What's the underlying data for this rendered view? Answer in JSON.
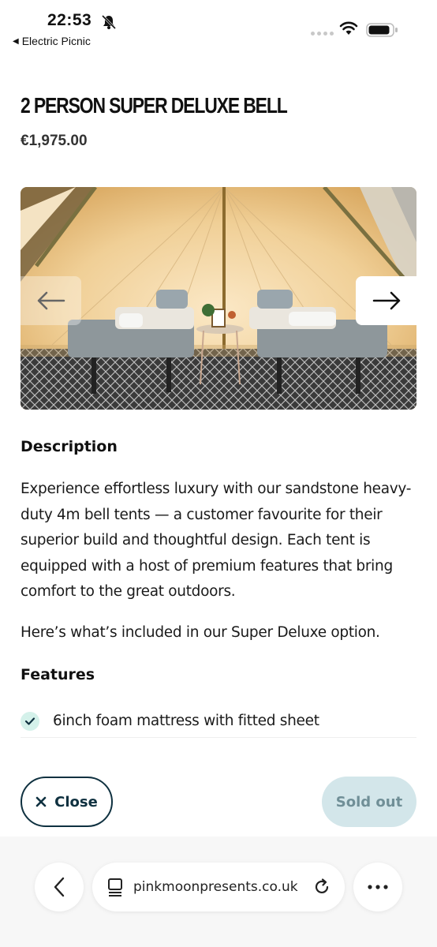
{
  "status_bar": {
    "time": "22:53",
    "back_app_label": "Electric Picnic",
    "icons": [
      "bell-slash-icon",
      "wifi-icon",
      "battery-icon"
    ]
  },
  "product": {
    "title": "2 PERSON SUPER DELUXE BELL",
    "price": "€1,975.00"
  },
  "gallery": {
    "prev_icon": "arrow-left-icon",
    "next_icon": "arrow-right-icon"
  },
  "description": {
    "heading": "Description",
    "paragraph_1": "Experience effortless luxury with our sandstone heavy-duty 4m bell tents — a customer favourite for their superior build and thoughtful design. Each tent is equipped with a host of premium features that bring  comfort to the great outdoors.",
    "paragraph_2": "Here’s what’s included in our Super Deluxe option."
  },
  "features": {
    "heading": "Features",
    "items": [
      "6inch foam mattress with fitted sheet"
    ]
  },
  "actions": {
    "close_label": "Close",
    "sold_out_label": "Sold out"
  },
  "browser": {
    "url": "pinkmoonpresents.co.uk",
    "icons": [
      "chevron-left-icon",
      "tabs-icon",
      "reload-icon",
      "more-icon"
    ]
  },
  "colors": {
    "brand_dark": "#0f3140",
    "check_bg": "#d4f1ea",
    "sold_out_bg": "#d3e6ea",
    "sold_out_text": "#708f97"
  }
}
